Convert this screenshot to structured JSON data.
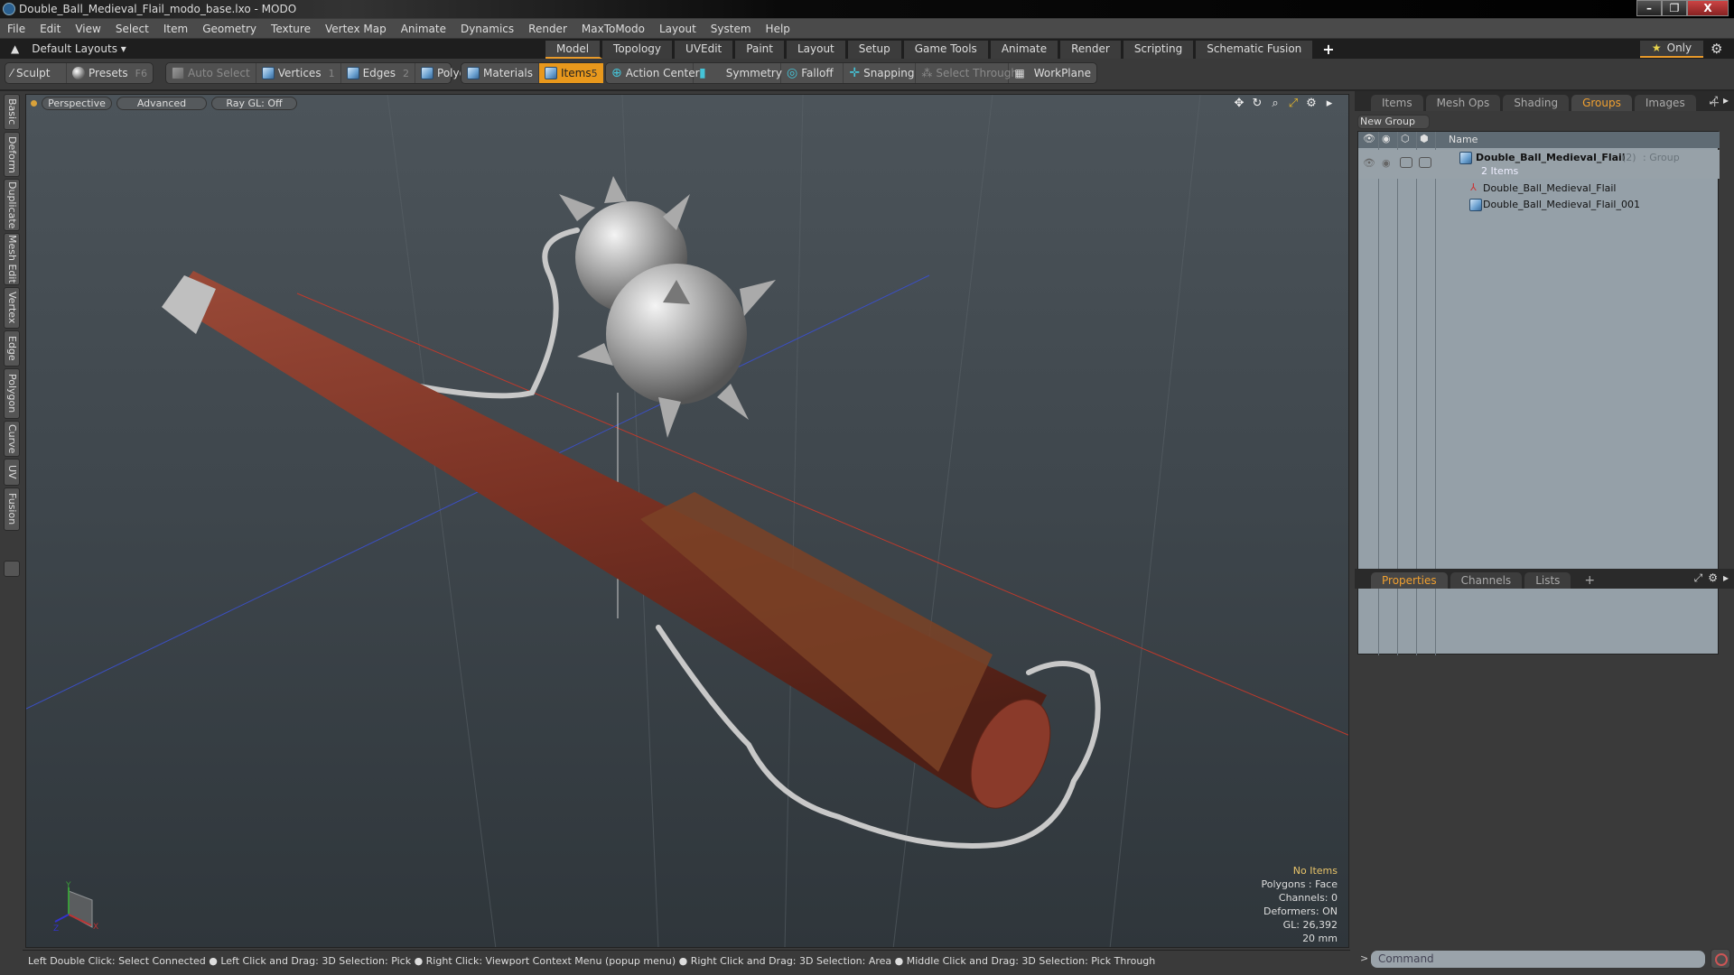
{
  "window": {
    "title": "Double_Ball_Medieval_Flail_modo_base.lxo - MODO",
    "buttons": [
      "–",
      "❐",
      "X"
    ]
  },
  "menu": [
    "File",
    "Edit",
    "View",
    "Select",
    "Item",
    "Geometry",
    "Texture",
    "Vertex Map",
    "Animate",
    "Dynamics",
    "Render",
    "MaxToModo",
    "Layout",
    "System",
    "Help"
  ],
  "layoutbar": {
    "layouts_label": "Default Layouts ▾",
    "tabs": [
      "Model",
      "Topology",
      "UVEdit",
      "Paint",
      "Layout",
      "Setup",
      "Game Tools",
      "Animate",
      "Render",
      "Scripting",
      "Schematic Fusion"
    ],
    "active_tab": "Model",
    "add_tab": "+",
    "only_label": "Only"
  },
  "toolbar": {
    "sculpt": "Sculpt",
    "presets": "Presets",
    "presets_key": "F6",
    "auto_select": "Auto Select",
    "vertices": "Vertices",
    "vertices_key": "1",
    "edges": "Edges",
    "edges_key": "2",
    "polygons": "Polygons",
    "materials": "Materials",
    "items": "Items",
    "items_key": "5",
    "action_center": "Action Center",
    "symmetry": "Symmetry",
    "falloff": "Falloff",
    "snapping": "Snapping",
    "select_through": "Select Through",
    "workplane": "WorkPlane"
  },
  "left_tabs": [
    "Basic",
    "Deform",
    "Duplicate",
    "Mesh Edit",
    "Vertex",
    "Edge",
    "Polygon",
    "Curve",
    "UV",
    "Fusion"
  ],
  "viewport": {
    "view": "Perspective",
    "shading": "Advanced",
    "raygl": "Ray GL: Off",
    "info": {
      "selection": "No Items",
      "polygons": "Polygons : Face",
      "channels": "Channels: 0",
      "deformers": "Deformers: ON",
      "gl": "GL: 26,392",
      "grid": "20 mm"
    },
    "axis": {
      "x": "X",
      "y": "Y",
      "z": "Z"
    }
  },
  "status_hint": "Left Double Click: Select Connected ● Left Click and Drag: 3D Selection: Pick ● Right Click: Viewport Context Menu (popup menu) ● Right Click and Drag: 3D Selection: Area ● Middle Click and Drag: 3D Selection: Pick Through",
  "top_panel": {
    "tabs": [
      "Items",
      "Mesh Ops",
      "Shading",
      "Groups",
      "Images"
    ],
    "active_tab": "Groups",
    "add": "+",
    "new_group": "New Group",
    "name_header": "Name",
    "group": {
      "name": "Double_Ball_Medieval_Flail",
      "count": "(2)",
      "type": ": Group",
      "subtitle": "2 Items"
    },
    "children": [
      "Double_Ball_Medieval_Flail",
      "Double_Ball_Medieval_Flail_001"
    ]
  },
  "bottom_panel": {
    "tabs": [
      "Properties",
      "Channels",
      "Lists"
    ],
    "active_tab": "Properties",
    "add": "+"
  },
  "command": {
    "placeholder": "Command",
    "prompt": ">"
  }
}
